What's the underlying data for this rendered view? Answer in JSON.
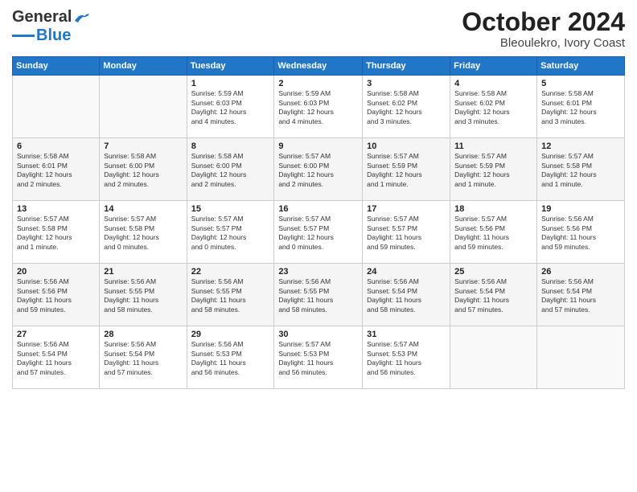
{
  "logo": {
    "line1": "General",
    "line2": "Blue"
  },
  "title": "October 2024",
  "subtitle": "Bleoulekro, Ivory Coast",
  "weekdays": [
    "Sunday",
    "Monday",
    "Tuesday",
    "Wednesday",
    "Thursday",
    "Friday",
    "Saturday"
  ],
  "weeks": [
    [
      {
        "day": "",
        "info": ""
      },
      {
        "day": "",
        "info": ""
      },
      {
        "day": "1",
        "info": "Sunrise: 5:59 AM\nSunset: 6:03 PM\nDaylight: 12 hours\nand 4 minutes."
      },
      {
        "day": "2",
        "info": "Sunrise: 5:59 AM\nSunset: 6:03 PM\nDaylight: 12 hours\nand 4 minutes."
      },
      {
        "day": "3",
        "info": "Sunrise: 5:58 AM\nSunset: 6:02 PM\nDaylight: 12 hours\nand 3 minutes."
      },
      {
        "day": "4",
        "info": "Sunrise: 5:58 AM\nSunset: 6:02 PM\nDaylight: 12 hours\nand 3 minutes."
      },
      {
        "day": "5",
        "info": "Sunrise: 5:58 AM\nSunset: 6:01 PM\nDaylight: 12 hours\nand 3 minutes."
      }
    ],
    [
      {
        "day": "6",
        "info": "Sunrise: 5:58 AM\nSunset: 6:01 PM\nDaylight: 12 hours\nand 2 minutes."
      },
      {
        "day": "7",
        "info": "Sunrise: 5:58 AM\nSunset: 6:00 PM\nDaylight: 12 hours\nand 2 minutes."
      },
      {
        "day": "8",
        "info": "Sunrise: 5:58 AM\nSunset: 6:00 PM\nDaylight: 12 hours\nand 2 minutes."
      },
      {
        "day": "9",
        "info": "Sunrise: 5:57 AM\nSunset: 6:00 PM\nDaylight: 12 hours\nand 2 minutes."
      },
      {
        "day": "10",
        "info": "Sunrise: 5:57 AM\nSunset: 5:59 PM\nDaylight: 12 hours\nand 1 minute."
      },
      {
        "day": "11",
        "info": "Sunrise: 5:57 AM\nSunset: 5:59 PM\nDaylight: 12 hours\nand 1 minute."
      },
      {
        "day": "12",
        "info": "Sunrise: 5:57 AM\nSunset: 5:58 PM\nDaylight: 12 hours\nand 1 minute."
      }
    ],
    [
      {
        "day": "13",
        "info": "Sunrise: 5:57 AM\nSunset: 5:58 PM\nDaylight: 12 hours\nand 1 minute."
      },
      {
        "day": "14",
        "info": "Sunrise: 5:57 AM\nSunset: 5:58 PM\nDaylight: 12 hours\nand 0 minutes."
      },
      {
        "day": "15",
        "info": "Sunrise: 5:57 AM\nSunset: 5:57 PM\nDaylight: 12 hours\nand 0 minutes."
      },
      {
        "day": "16",
        "info": "Sunrise: 5:57 AM\nSunset: 5:57 PM\nDaylight: 12 hours\nand 0 minutes."
      },
      {
        "day": "17",
        "info": "Sunrise: 5:57 AM\nSunset: 5:57 PM\nDaylight: 11 hours\nand 59 minutes."
      },
      {
        "day": "18",
        "info": "Sunrise: 5:57 AM\nSunset: 5:56 PM\nDaylight: 11 hours\nand 59 minutes."
      },
      {
        "day": "19",
        "info": "Sunrise: 5:56 AM\nSunset: 5:56 PM\nDaylight: 11 hours\nand 59 minutes."
      }
    ],
    [
      {
        "day": "20",
        "info": "Sunrise: 5:56 AM\nSunset: 5:56 PM\nDaylight: 11 hours\nand 59 minutes."
      },
      {
        "day": "21",
        "info": "Sunrise: 5:56 AM\nSunset: 5:55 PM\nDaylight: 11 hours\nand 58 minutes."
      },
      {
        "day": "22",
        "info": "Sunrise: 5:56 AM\nSunset: 5:55 PM\nDaylight: 11 hours\nand 58 minutes."
      },
      {
        "day": "23",
        "info": "Sunrise: 5:56 AM\nSunset: 5:55 PM\nDaylight: 11 hours\nand 58 minutes."
      },
      {
        "day": "24",
        "info": "Sunrise: 5:56 AM\nSunset: 5:54 PM\nDaylight: 11 hours\nand 58 minutes."
      },
      {
        "day": "25",
        "info": "Sunrise: 5:56 AM\nSunset: 5:54 PM\nDaylight: 11 hours\nand 57 minutes."
      },
      {
        "day": "26",
        "info": "Sunrise: 5:56 AM\nSunset: 5:54 PM\nDaylight: 11 hours\nand 57 minutes."
      }
    ],
    [
      {
        "day": "27",
        "info": "Sunrise: 5:56 AM\nSunset: 5:54 PM\nDaylight: 11 hours\nand 57 minutes."
      },
      {
        "day": "28",
        "info": "Sunrise: 5:56 AM\nSunset: 5:54 PM\nDaylight: 11 hours\nand 57 minutes."
      },
      {
        "day": "29",
        "info": "Sunrise: 5:56 AM\nSunset: 5:53 PM\nDaylight: 11 hours\nand 56 minutes."
      },
      {
        "day": "30",
        "info": "Sunrise: 5:57 AM\nSunset: 5:53 PM\nDaylight: 11 hours\nand 56 minutes."
      },
      {
        "day": "31",
        "info": "Sunrise: 5:57 AM\nSunset: 5:53 PM\nDaylight: 11 hours\nand 56 minutes."
      },
      {
        "day": "",
        "info": ""
      },
      {
        "day": "",
        "info": ""
      }
    ]
  ]
}
